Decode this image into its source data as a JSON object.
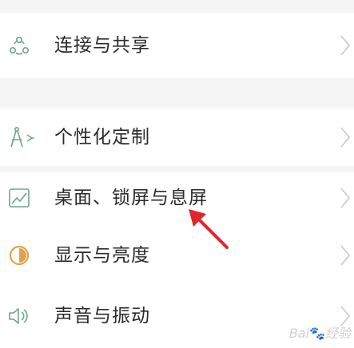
{
  "settings": {
    "items": [
      {
        "label": "连接与共享",
        "icon": "connect-share-icon"
      },
      {
        "label": "个性化定制",
        "icon": "personalize-icon"
      },
      {
        "label": "桌面、锁屏与息屏",
        "icon": "wallpaper-icon"
      },
      {
        "label": "显示与亮度",
        "icon": "display-brightness-icon"
      },
      {
        "label": "声音与振动",
        "icon": "sound-vibration-icon"
      }
    ]
  },
  "watermark": {
    "brand": "Bai",
    "paw": "🐾",
    "suffix": "经验"
  },
  "colors": {
    "icon": "#6aa58a",
    "text": "#2a2a2a",
    "chevron": "#c9c9c9",
    "arrow": "#e0262c",
    "divider": "#f5f5f5"
  }
}
